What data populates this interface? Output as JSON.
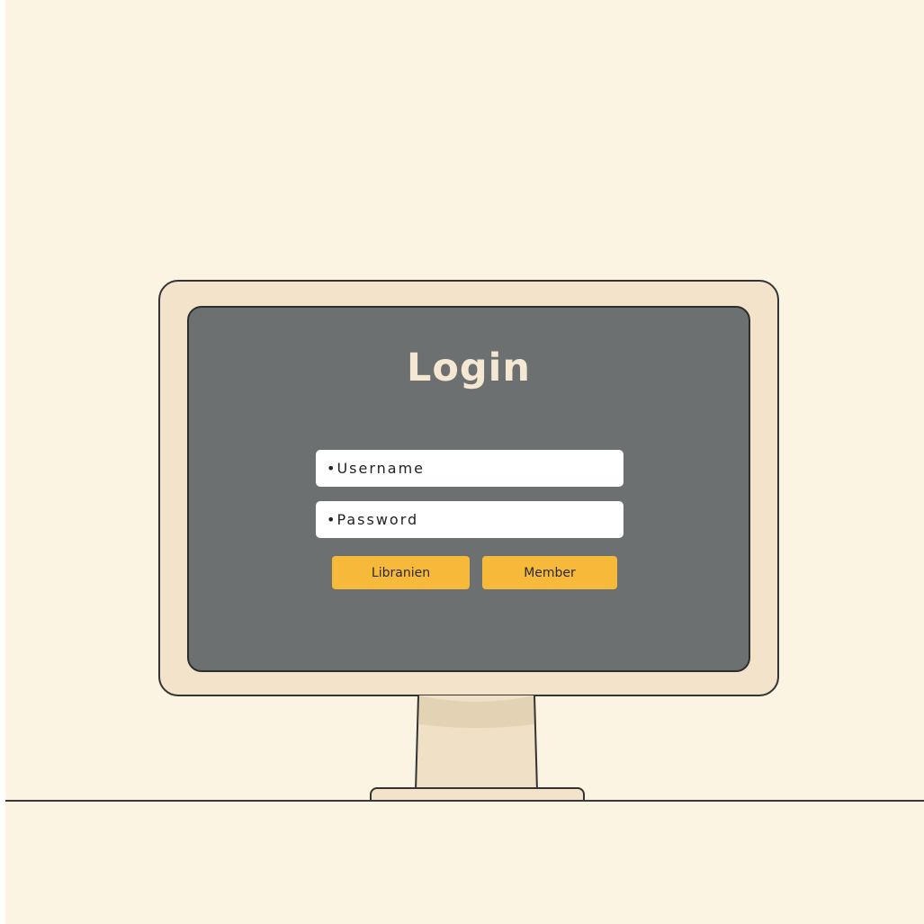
{
  "login": {
    "title": "Login",
    "username_placeholder": "•Username",
    "password_placeholder": "•Password"
  },
  "buttons": {
    "librarian_label": "Libranien",
    "member_label": "Member"
  },
  "colors": {
    "background": "#fcf4e3",
    "monitor_frame": "#f2e3ca",
    "screen": "#6d7070",
    "title_text": "#f4e8d2",
    "button": "#f6b93a",
    "outline": "#343434"
  }
}
